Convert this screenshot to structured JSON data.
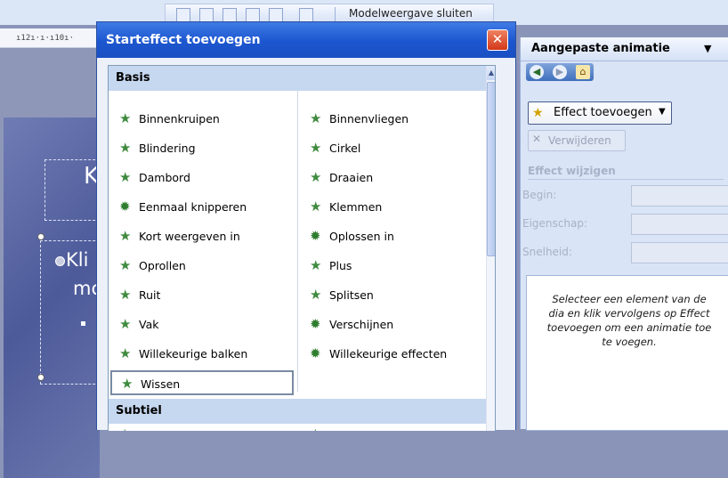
{
  "toolbar": {
    "close_master_view": "Modelweergave sluiten"
  },
  "ruler": {
    "text": "ı12ı·ı·ı10ı·"
  },
  "slide": {
    "title_fragment": "K",
    "body_line1": "Kli",
    "body_line2": "mc"
  },
  "dialog": {
    "title": "Starteffect toevoegen",
    "close_glyph": "✕",
    "groups": [
      {
        "label": "Basis"
      },
      {
        "label": "Subtiel"
      }
    ],
    "basis_left": [
      "Binnenkruipen",
      "Blindering",
      "Dambord",
      "Eenmaal knipperen",
      "Kort weergeven in",
      "Oprollen",
      "Ruit",
      "Vak",
      "Willekeurige balken",
      "Wissen"
    ],
    "basis_right": [
      "Binnenvliegen",
      "Cirkel",
      "Draaien",
      "Klemmen",
      "Oplossen in",
      "Plus",
      "Splitsen",
      "Verschijnen",
      "Willekeurige effecten"
    ],
    "selected_item": "Wissen"
  },
  "taskpane": {
    "title": "Aangepaste animatie",
    "menu_arrow": "▼",
    "add_effect_label": "Effect toevoegen",
    "remove_label": "Verwijderen",
    "modify_section": "Effect wijzigen",
    "fields": [
      {
        "label": "Begin:",
        "value": ""
      },
      {
        "label": "Eigenschap:",
        "value": ""
      },
      {
        "label": "Snelheid:",
        "value": ""
      }
    ],
    "info_text": "Selecteer een element van de dia en klik vervolgens op Effect toevoegen om een animatie toe te voegen."
  }
}
